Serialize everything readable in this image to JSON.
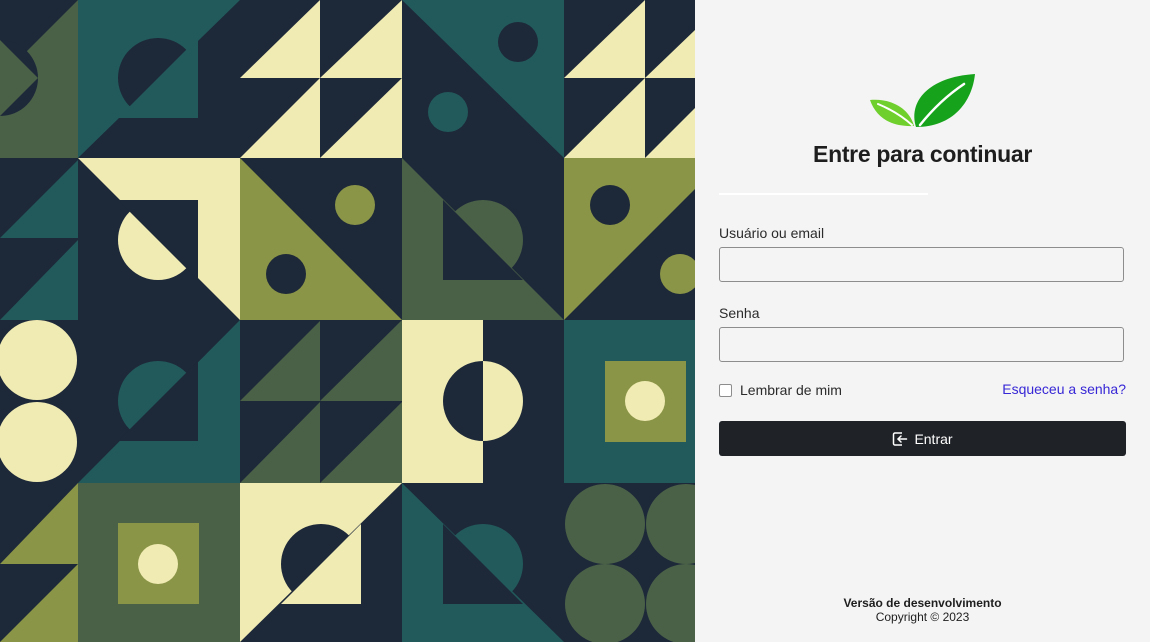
{
  "colors": {
    "navy": "#1d2839",
    "teal": "#225a5b",
    "olive": "#8b9547",
    "cream": "#f0ebb3",
    "forest": "#4a6147",
    "panel_bg": "#f4f4f4",
    "button_bg": "#1f2227",
    "link": "#3727d6",
    "leaf_dark": "#16a31b",
    "leaf_light": "#6fcf2c"
  },
  "brand": {
    "logo_icon": "leaves-logo-icon"
  },
  "login": {
    "title": "Entre para continuar",
    "username_label": "Usuário ou email",
    "username_value": "",
    "username_placeholder": "",
    "password_label": "Senha",
    "password_value": "",
    "password_placeholder": "",
    "remember_label": "Lembrar de mim",
    "remember_checked": false,
    "forgot_label": "Esqueceu a senha?",
    "submit_label": "Entrar",
    "submit_icon": "login-icon"
  },
  "footer": {
    "version": "Versão de desenvolvimento",
    "copyright": "Copyright © 2023"
  }
}
